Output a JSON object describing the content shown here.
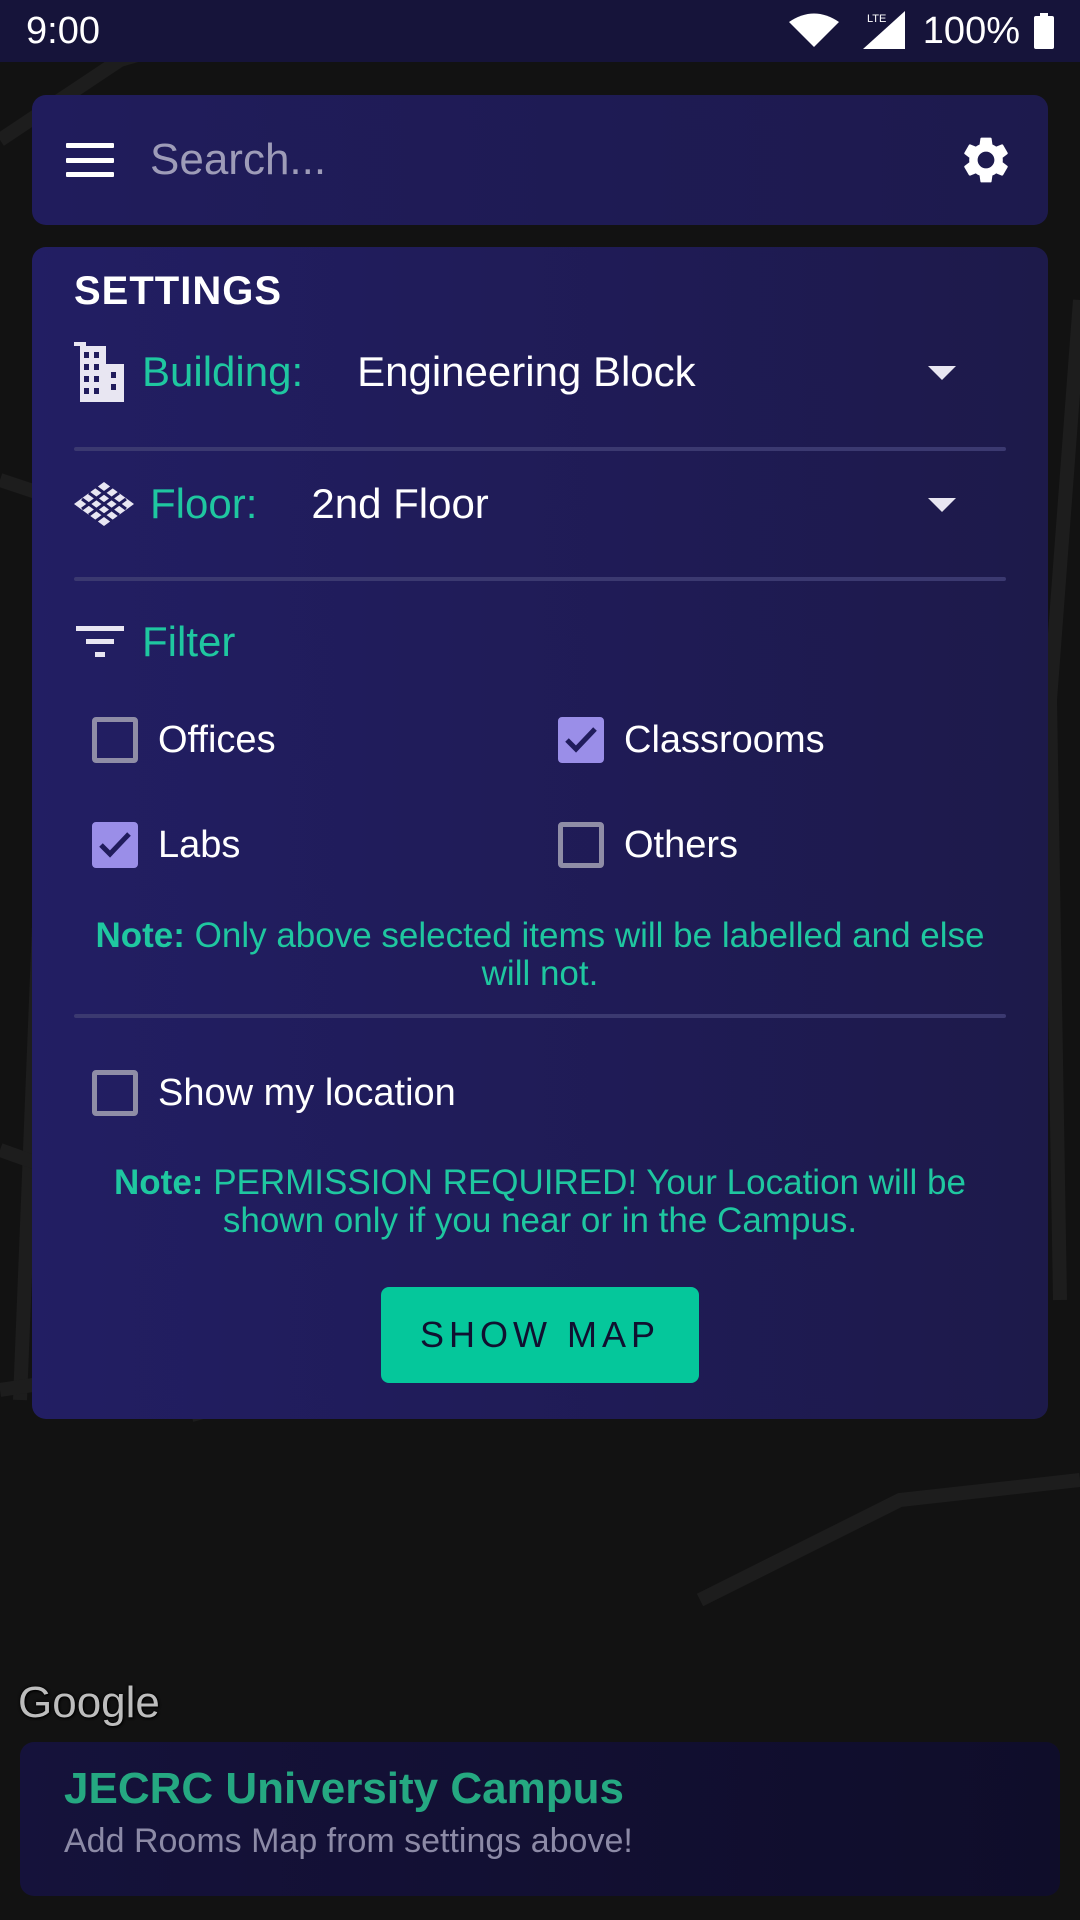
{
  "status_bar": {
    "time": "9:00",
    "network": "LTE",
    "battery": "100%"
  },
  "search": {
    "placeholder": "Search..."
  },
  "settings": {
    "title": "SETTINGS",
    "building": {
      "label": "Building:",
      "value": "Engineering Block"
    },
    "floor": {
      "label": "Floor:",
      "value": "2nd Floor"
    },
    "filter": {
      "label": "Filter",
      "options": [
        {
          "label": "Offices",
          "checked": false
        },
        {
          "label": "Classrooms",
          "checked": true
        },
        {
          "label": "Labs",
          "checked": true
        },
        {
          "label": "Others",
          "checked": false
        }
      ]
    },
    "filter_note": {
      "prefix": "Note:",
      "text": "Only above selected items will be labelled and else will not."
    },
    "show_location": {
      "label": "Show my location",
      "checked": false
    },
    "location_note": {
      "prefix": "Note:",
      "text": "PERMISSION REQUIRED! Your Location will be shown only if you near or in the Campus."
    },
    "show_map_label": "SHOW MAP"
  },
  "map": {
    "attribution": "Google"
  },
  "bottom_card": {
    "title": "JECRC University Campus",
    "subtitle": "Add Rooms Map from settings above!"
  },
  "colors": {
    "accent": "#1fc7a0",
    "button": "#05c79b",
    "card": "#201c5c",
    "checkbox": "#9a8ee8"
  }
}
